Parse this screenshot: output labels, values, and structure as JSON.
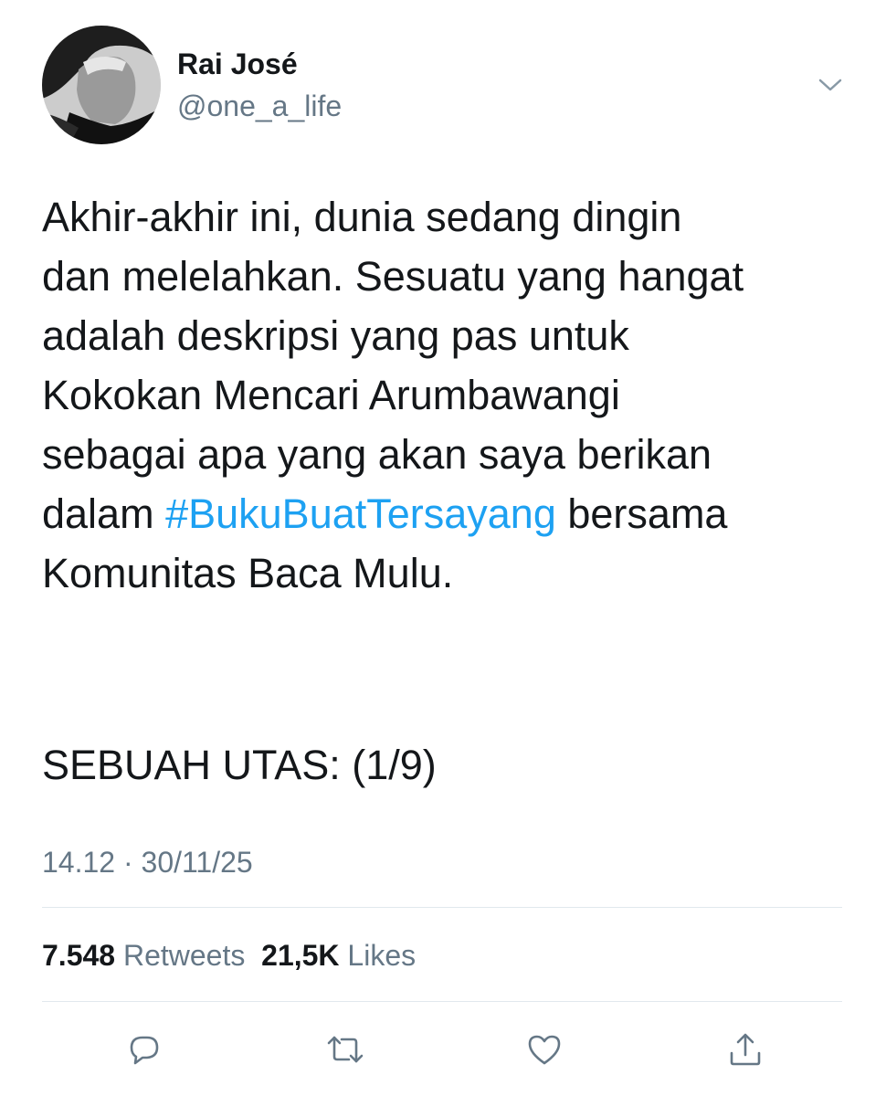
{
  "tweet": {
    "author": {
      "display_name": "Rai José",
      "handle": "@one_a_life"
    },
    "text_lines": [
      "Akhir-akhir ini, dunia sedang dingin",
      "dan melelahkan. Sesuatu yang hangat",
      "adalah deskripsi yang pas untuk",
      "Kokokan Mencari Arumbawangi",
      "sebagai apa yang akan saya berikan"
    ],
    "line6_before": "dalam ",
    "hashtag": "#BukuBuatTersayang",
    "line6_after": " bersama",
    "line7": "Komunitas Baca Mulu.",
    "thread_label": "SEBUAH UTAS: (1/9)",
    "timestamp": "14.12 · 30/11/25",
    "stats": {
      "retweets_count": "7.548",
      "retweets_label": "Retweets",
      "likes_count": "21,5K",
      "likes_label": "Likes"
    }
  },
  "icons": {
    "menu": "chevron-down-icon",
    "reply": "reply-icon",
    "retweet": "retweet-icon",
    "like": "heart-icon",
    "share": "share-icon"
  },
  "colors": {
    "text": "#14171a",
    "secondary": "#657786",
    "hashtag": "#1da1f2",
    "divider": "#e1e8ed"
  }
}
